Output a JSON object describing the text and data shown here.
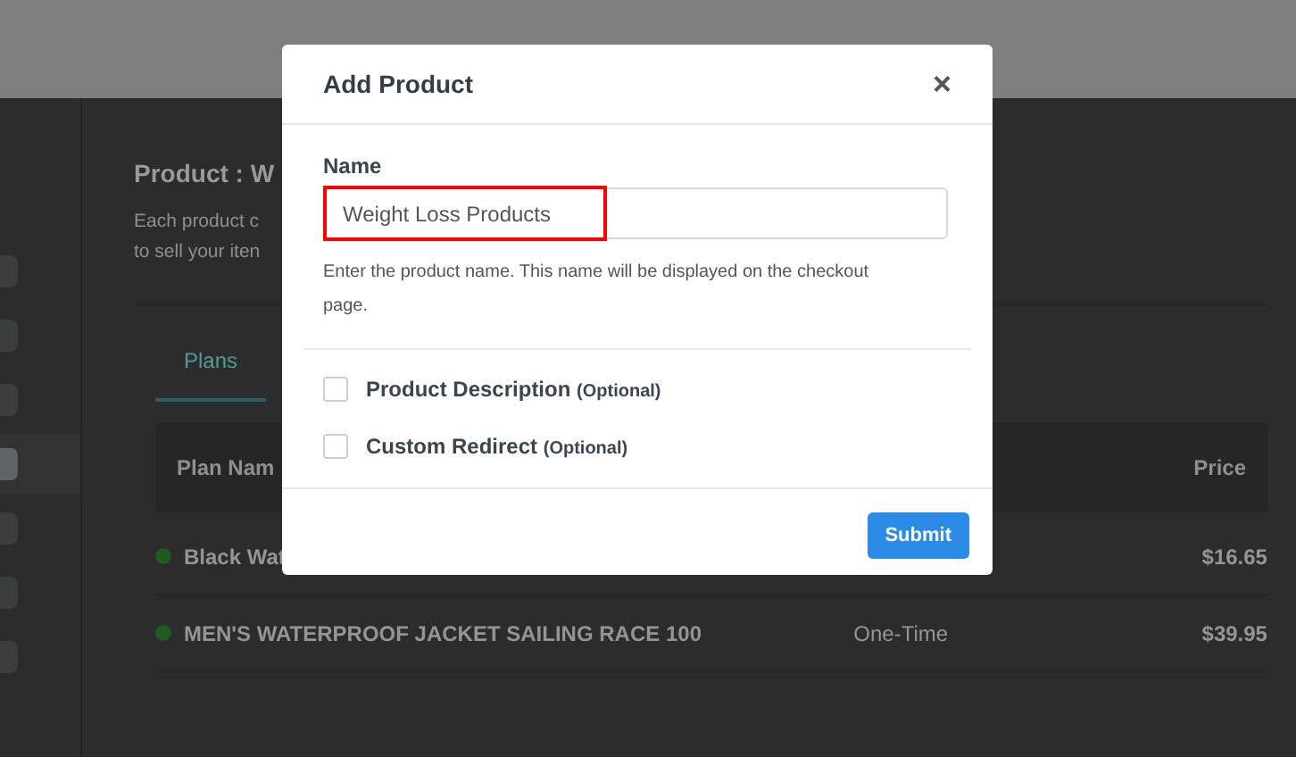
{
  "page": {
    "sidebar": {
      "items": [
        {
          "selected": false
        },
        {
          "selected": false
        },
        {
          "selected": false
        },
        {
          "selected": true
        },
        {
          "selected": false
        },
        {
          "selected": false
        },
        {
          "selected": false
        }
      ]
    },
    "title": "Product : W",
    "description": [
      "Each product c",
      "to sell your iten"
    ],
    "tabs": [
      {
        "label": "Plans",
        "selected": true
      }
    ],
    "table": {
      "columns": [
        "Plan Nam",
        "Price"
      ],
      "rows": [
        {
          "name": "Black Wat",
          "color": "#1f5a1f",
          "price": "$16.65"
        },
        {
          "name": "MEN'S WATERPROOF JACKET SAILING RACE 100",
          "color": "#1f5a1f",
          "type": "One-Time",
          "price": "$39.95"
        }
      ]
    }
  },
  "dialog": {
    "title": "Add Product",
    "close": "×",
    "field": {
      "label": "Name",
      "value": "Weight Loss Products",
      "highlighted": true,
      "help": "Enter the product name. This name will be displayed on the checkout page."
    },
    "options": [
      {
        "label": "Product Description",
        "note": "(Optional)",
        "checked": false
      },
      {
        "label": "Custom Redirect",
        "note": "(Optional)",
        "checked": false
      }
    ],
    "submit": "Submit"
  }
}
